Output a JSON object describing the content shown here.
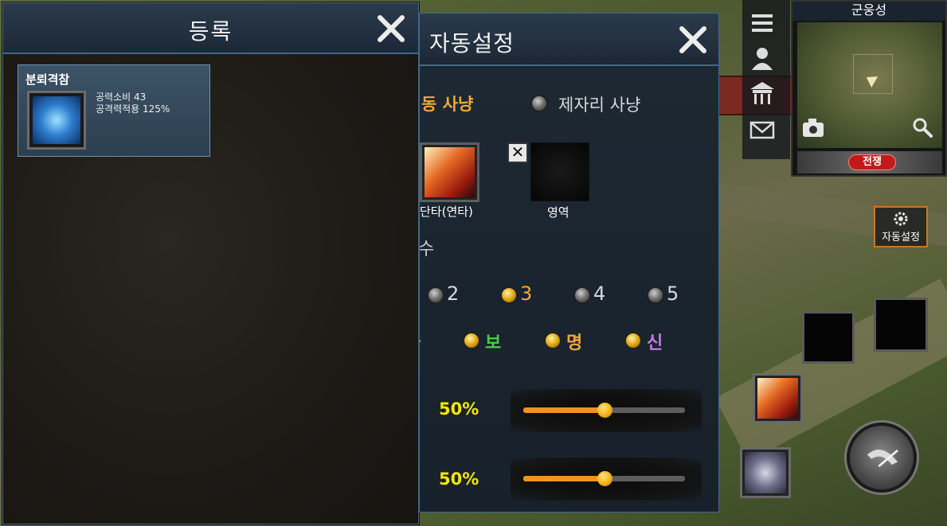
{
  "registration_panel": {
    "title": "등록",
    "skill_card": {
      "name": "분뢰격참",
      "stat_cost": "공력소비 43",
      "stat_attack": "공격력적용 125%"
    }
  },
  "auto_settings_panel": {
    "title": "자동설정",
    "hunt_mode": {
      "selected_label_partial": "동 사냥",
      "option_spot_label": "제자리 사냥"
    },
    "skill_slots": [
      {
        "label": "단타(연타)"
      },
      {
        "label": "영역"
      }
    ],
    "fragment_char": "수",
    "count_options": [
      {
        "label": "2",
        "selected": false
      },
      {
        "label": "3",
        "selected": true
      },
      {
        "label": "4",
        "selected": false
      },
      {
        "label": "5",
        "selected": false
      }
    ],
    "fragment_dot": "·",
    "grade_options": [
      {
        "label": "보",
        "selected": true,
        "color": "#4ec94e"
      },
      {
        "label": "명",
        "selected": true,
        "color": "#f0a83a"
      },
      {
        "label": "신",
        "selected": true,
        "color": "#c67ae8"
      }
    ],
    "sliders": [
      {
        "value_label": "50%",
        "value": 0.5
      },
      {
        "value_label": "50%",
        "value": 0.5
      }
    ]
  },
  "hud": {
    "minimap_title": "군웅성",
    "war_badge": "전쟁",
    "auto_settings_button": "자동설정"
  },
  "colors": {
    "accent_orange": "#f0a83a",
    "slider_fill": "#f0941e",
    "percent_yellow": "#f5e600",
    "panel_border": "#3b6a90"
  }
}
